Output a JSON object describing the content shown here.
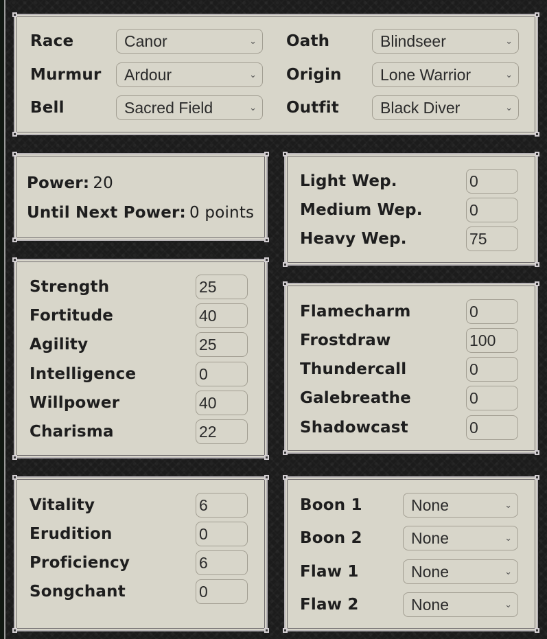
{
  "identity": {
    "fields": [
      {
        "label": "Race",
        "value": "Canor"
      },
      {
        "label": "Murmur",
        "value": "Ardour"
      },
      {
        "label": "Bell",
        "value": "Sacred Field"
      },
      {
        "label": "Oath",
        "value": "Blindseer"
      },
      {
        "label": "Origin",
        "value": "Lone Warrior"
      },
      {
        "label": "Outfit",
        "value": "Black Diver"
      }
    ]
  },
  "power": {
    "power_label": "Power:",
    "power_value": "20",
    "next_label": "Until Next Power:",
    "next_value": "0 points"
  },
  "weapons": [
    {
      "label": "Light Wep.",
      "value": "0"
    },
    {
      "label": "Medium Wep.",
      "value": "0"
    },
    {
      "label": "Heavy Wep.",
      "value": "75"
    }
  ],
  "attributes": [
    {
      "label": "Strength",
      "value": "25"
    },
    {
      "label": "Fortitude",
      "value": "40"
    },
    {
      "label": "Agility",
      "value": "25"
    },
    {
      "label": "Intelligence",
      "value": "0"
    },
    {
      "label": "Willpower",
      "value": "40"
    },
    {
      "label": "Charisma",
      "value": "22"
    }
  ],
  "attunements": [
    {
      "label": "Flamecharm",
      "value": "0"
    },
    {
      "label": "Frostdraw",
      "value": "100"
    },
    {
      "label": "Thundercall",
      "value": "0"
    },
    {
      "label": "Galebreathe",
      "value": "0"
    },
    {
      "label": "Shadowcast",
      "value": "0"
    }
  ],
  "investments": [
    {
      "label": "Vitality",
      "value": "6"
    },
    {
      "label": "Erudition",
      "value": "0"
    },
    {
      "label": "Proficiency",
      "value": "6"
    },
    {
      "label": "Songchant",
      "value": "0"
    }
  ],
  "traits": [
    {
      "label": "Boon 1",
      "value": "None"
    },
    {
      "label": "Boon 2",
      "value": "None"
    },
    {
      "label": "Flaw 1",
      "value": "None"
    },
    {
      "label": "Flaw 2",
      "value": "None"
    }
  ],
  "icons": {
    "dropdown": "chevron-down-icon",
    "dropdown_glyph": "⌄"
  }
}
